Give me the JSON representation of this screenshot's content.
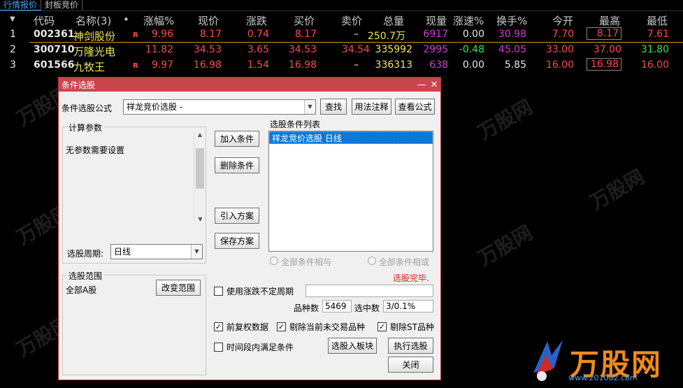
{
  "tabs": [
    "行情报价",
    "封板竞价"
  ],
  "table": {
    "headers": {
      "sort_arrow": "▼",
      "code": "代码",
      "name": "名称(3)",
      "dot": "•",
      "pct": "涨幅%",
      "price": "现价",
      "change": "涨跌",
      "bid": "买价",
      "ask": "卖价",
      "volume": "总量",
      "cur_vol": "现量",
      "speed": "涨速%",
      "turnover": "换手%",
      "open": "今开",
      "high": "最高",
      "low": "最低"
    },
    "rows": [
      {
        "idx": "1",
        "code": "002361",
        "name": "神剑股份",
        "flag": "R",
        "pct": "9.96",
        "price": "8.17",
        "change": "0.74",
        "bid": "8.17",
        "ask": "–",
        "volume": "250.7万",
        "cur_vol": "6917",
        "speed": "0.00",
        "turnover": "30.98",
        "open": "7.70",
        "high": "8.17",
        "low": "7.61"
      },
      {
        "idx": "2",
        "code": "300710",
        "name": "万隆光电",
        "flag": "",
        "pct": "11.82",
        "price": "34.53",
        "change": "3.65",
        "bid": "34.53",
        "ask": "34.54",
        "volume": "335992",
        "cur_vol": "2995",
        "speed": "-0.48",
        "turnover": "45.05",
        "open": "33.00",
        "high": "37.00",
        "low": "31.80"
      },
      {
        "idx": "3",
        "code": "601566",
        "name": "九牧王",
        "flag": "R",
        "pct": "9.97",
        "price": "16.98",
        "change": "1.54",
        "bid": "16.98",
        "ask": "–",
        "volume": "336313",
        "cur_vol": "638",
        "speed": "0.00",
        "turnover": "5.85",
        "open": "16.00",
        "high": "16.98",
        "low": "16.00"
      }
    ]
  },
  "dialog": {
    "title": "条件选股",
    "minimize": "—",
    "close": "✕",
    "formula_label": "条件选股公式",
    "formula_value": "祥龙竞价选股  -",
    "btn_find": "查找",
    "btn_usage": "用法注释",
    "btn_view": "查看公式",
    "params_title": "计算参数",
    "params_text": "无参数需要设置",
    "period_label": "选股周期:",
    "period_value": "日线",
    "btn_add": "加入条件",
    "btn_delete": "删除条件",
    "btn_import": "引入方案",
    "btn_save": "保存方案",
    "cond_list_label": "选股条件列表",
    "cond_items": [
      "祥龙竞价选股  日线"
    ],
    "radio_and": "全部条件相与",
    "radio_or": "全部条件相或",
    "status": "选股完毕.",
    "range_title": "选股范围",
    "range_value": "全部A股",
    "btn_change_range": "改变范围",
    "chk_unfixed": "使用涨跌不定周期",
    "count_label": "品种数",
    "count_value": "5469",
    "selected_label": "选中数",
    "selected_value": "3/0.1%",
    "chk_adjust": "前复权数据",
    "chk_exclude_suspended": "剔除当前未交易品种",
    "chk_exclude_st": "剔除ST品种",
    "chk_timerange": "时间段内满足条件",
    "btn_to_block": "选股入板块",
    "btn_execute": "执行选股",
    "btn_close": "关闭"
  },
  "logo": {
    "text": "万股网",
    "url": "www.201082.com"
  }
}
